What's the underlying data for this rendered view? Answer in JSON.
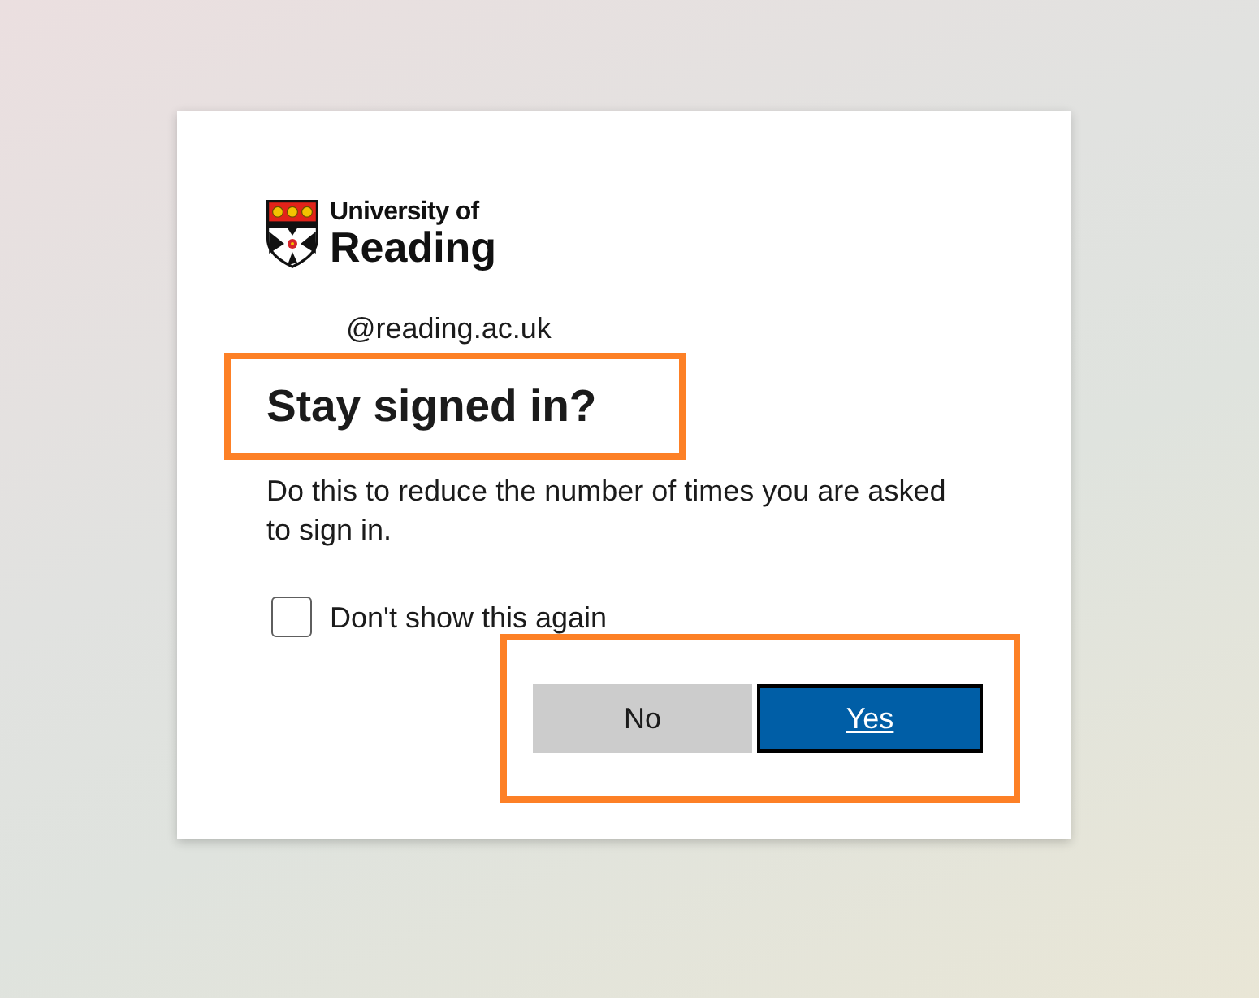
{
  "logo": {
    "line_1": "University of",
    "line_2": "Reading"
  },
  "account": {
    "email": "@reading.ac.uk"
  },
  "heading": {
    "text": "Stay signed in?",
    "highlighted": true
  },
  "description": "Do this to reduce the number of times you are asked to sign in.",
  "dont_show_again": {
    "label": "Don't show this again",
    "checked": false
  },
  "actions": {
    "highlighted": true,
    "buttons": [
      {
        "label": "No",
        "kind": "secondary",
        "focused": false
      },
      {
        "label": "Yes",
        "kind": "primary",
        "focused": true
      }
    ]
  }
}
